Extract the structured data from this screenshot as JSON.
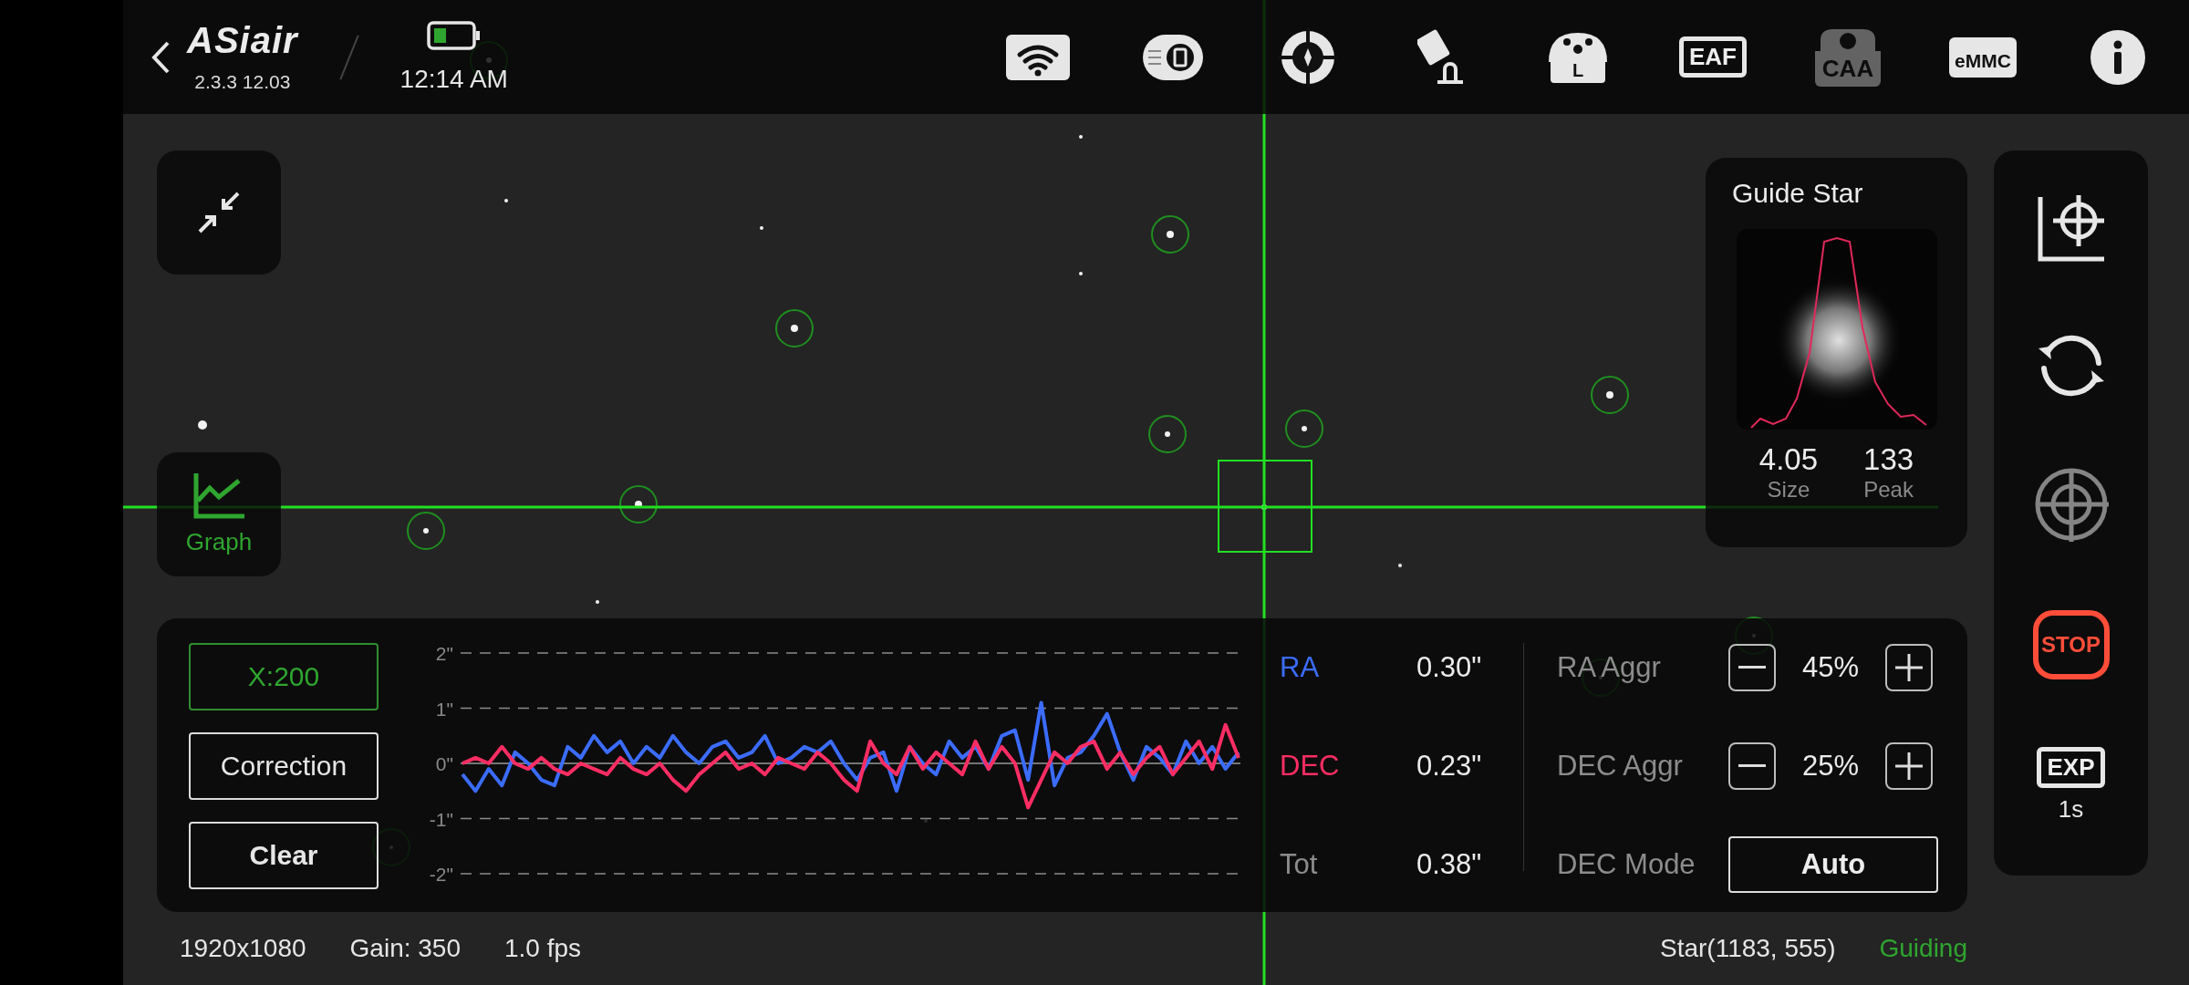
{
  "top_bar": {
    "logo": "ASiair",
    "version": "2.3.3 12.03",
    "time": "12:14 AM",
    "devices": [
      {
        "kind": "wifi",
        "disabled": false
      },
      {
        "kind": "storage",
        "disabled": false
      },
      {
        "kind": "guide",
        "disabled": false
      },
      {
        "kind": "mount",
        "disabled": false
      },
      {
        "kind": "filter",
        "label": "L",
        "disabled": false
      },
      {
        "kind": "focuser",
        "label": "EAF",
        "disabled": false
      },
      {
        "kind": "rotator",
        "label": "CAA",
        "disabled": true
      },
      {
        "kind": "emmc",
        "label": "eMMC",
        "disabled": false
      },
      {
        "kind": "info",
        "disabled": false
      }
    ]
  },
  "view_buttons": [
    {
      "kind": "shrink",
      "selected": false
    },
    {
      "kind": "graph",
      "label": "Graph",
      "selected": true
    }
  ],
  "guide_star": {
    "title": "Guide Star",
    "stats": [
      {
        "value": "4.05",
        "label": "Size"
      },
      {
        "value": "133",
        "label": "Peak"
      }
    ]
  },
  "toolbar": [
    {
      "kind": "locate",
      "disabled": false
    },
    {
      "kind": "refresh",
      "disabled": false
    },
    {
      "kind": "target",
      "disabled": true
    },
    {
      "kind": "stop",
      "label": "STOP",
      "disabled": false
    },
    {
      "kind": "exposure",
      "label": "EXP",
      "value": "1s",
      "disabled": false
    }
  ],
  "guide_panel": {
    "scale_button": "X:200",
    "buttons": [
      {
        "kind": "toggle",
        "label": "Correction"
      },
      {
        "kind": "action",
        "label": "Clear"
      }
    ],
    "chart_data": {
      "type": "line",
      "ylim": [
        -2,
        2
      ],
      "yticks": [
        {
          "value": 2,
          "label": "2\""
        },
        {
          "value": 1,
          "label": "1\""
        },
        {
          "value": 0,
          "label": "0\""
        },
        {
          "value": -1,
          "label": "-1\""
        },
        {
          "value": -2,
          "label": "-2\""
        }
      ],
      "series": [
        {
          "color": "#3b6cff",
          "values": [
            -0.2,
            -0.5,
            -0.1,
            -0.4,
            0.2,
            0.0,
            -0.3,
            -0.4,
            0.3,
            0.1,
            0.5,
            0.2,
            0.4,
            0.0,
            0.3,
            0.1,
            0.5,
            0.2,
            0.0,
            0.3,
            0.4,
            0.1,
            0.2,
            0.5,
            0.0,
            0.1,
            0.3,
            0.2,
            0.4,
            0.0,
            -0.3,
            0.1,
            0.2,
            -0.5,
            0.3,
            0.0,
            -0.2,
            0.4,
            0.1,
            0.3,
            -0.1,
            0.5,
            0.6,
            -0.3,
            1.1,
            -0.4,
            0.1,
            0.2,
            0.5,
            0.9,
            0.2,
            -0.3,
            0.3,
            0.1,
            -0.2,
            0.4,
            0.0,
            0.3,
            -0.1,
            0.2
          ]
        },
        {
          "color": "#ff2d64",
          "values": [
            0.0,
            0.1,
            0.0,
            0.3,
            0.0,
            -0.1,
            0.1,
            -0.1,
            -0.2,
            0.0,
            -0.1,
            -0.2,
            0.1,
            -0.1,
            -0.2,
            0.0,
            -0.3,
            -0.5,
            -0.2,
            0.0,
            0.2,
            -0.1,
            0.0,
            -0.2,
            0.1,
            0.0,
            -0.1,
            0.2,
            0.0,
            -0.3,
            -0.5,
            0.4,
            0.0,
            -0.2,
            0.3,
            -0.1,
            0.2,
            0.0,
            -0.2,
            0.4,
            -0.1,
            0.3,
            0.0,
            -0.8,
            -0.3,
            0.2,
            0.0,
            0.3,
            0.4,
            -0.1,
            0.2,
            -0.2,
            0.1,
            0.3,
            -0.2,
            0.1,
            0.4,
            -0.1,
            0.7,
            0.1
          ]
        }
      ]
    },
    "errors": [
      {
        "label": "RA",
        "value": "0.30\"",
        "color": "#3b6cff"
      },
      {
        "label": "DEC",
        "value": "0.23\"",
        "color": "#ff2d64"
      },
      {
        "label": "Tot",
        "value": "0.38\"",
        "color": "#8c8c8c"
      }
    ],
    "settings": [
      {
        "kind": "stepper",
        "label": "RA Aggr",
        "value": "45%"
      },
      {
        "kind": "stepper",
        "label": "DEC Aggr",
        "value": "25%"
      },
      {
        "kind": "select",
        "label": "DEC Mode",
        "value": "Auto"
      }
    ]
  },
  "status_bar": {
    "resolution": "1920x1080",
    "gain": "Gain: 350",
    "fps": "1.0 fps",
    "star": "Star(1183, 555)",
    "state": "Guiding"
  }
}
